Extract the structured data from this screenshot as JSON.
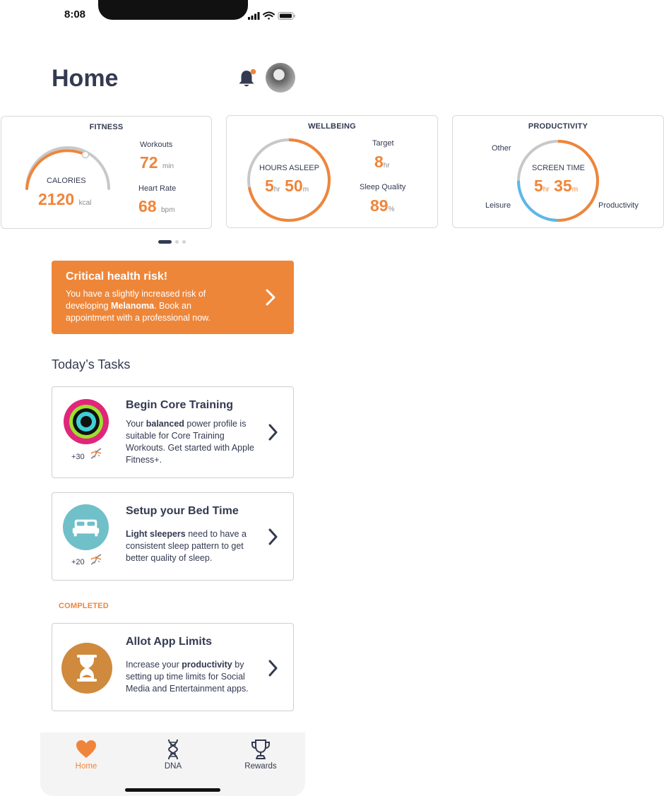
{
  "status_bar": {
    "time": "8:08"
  },
  "header": {
    "title": "Home"
  },
  "cards": {
    "fitness": {
      "title": "FITNESS",
      "calories_label": "CALORIES",
      "calories_value": "2120",
      "calories_unit": "kcal",
      "workouts_label": "Workouts",
      "workouts_value": "72",
      "workouts_unit": "min",
      "heart_rate_label": "Heart Rate",
      "heart_rate_value": "68",
      "heart_rate_unit": "bpm"
    },
    "wellbeing": {
      "title": "WELLBEING",
      "hours_label": "HOURS ASLEEP",
      "hours_value": "5",
      "hours_unit": "hr",
      "minutes_value": "50",
      "minutes_unit": "m",
      "target_label": "Target",
      "target_value": "8",
      "target_unit": "hr",
      "quality_label": "Sleep Quality",
      "quality_value": "89",
      "quality_unit": "%"
    },
    "productivity": {
      "title": "PRODUCTIVITY",
      "screen_label": "SCREEN TIME",
      "hours_value": "5",
      "hours_unit": "hr",
      "minutes_value": "35",
      "minutes_unit": "m",
      "legend_other": "Other",
      "legend_leisure": "Leisure",
      "legend_productivity": "Productivity"
    }
  },
  "alert": {
    "title": "Critical health risk!",
    "body_prefix": "You have a slightly increased risk of developing ",
    "body_bold": "Melanoma",
    "body_suffix": ". Book an appointment with a professional now."
  },
  "tasks_section": {
    "title": "Today’s Tasks"
  },
  "tasks": [
    {
      "title": "Begin Core Training",
      "desc_prefix": "Your ",
      "desc_bold": "balanced",
      "desc_suffix": " power profile is suitable for Core Training Workouts. Get started with Apple Fitness+.",
      "points": "+30"
    },
    {
      "title": "Setup your Bed Time",
      "desc_prefix": "",
      "desc_bold": "Light sleepers",
      "desc_suffix": " need to have a consistent sleep pattern to get better quality of sleep.",
      "points": "+20"
    }
  ],
  "completed_section": {
    "label": "COMPLETED"
  },
  "completed_tasks": [
    {
      "title": "Allot App Limits",
      "desc_prefix": "Increase your ",
      "desc_bold": "productivity",
      "desc_suffix": " by setting up time limits for Social Media and Entertainment apps."
    }
  ],
  "tabbar": {
    "items": [
      {
        "label": "Home",
        "icon": "heart-icon",
        "active": true
      },
      {
        "label": "DNA",
        "icon": "dna-icon",
        "active": false
      },
      {
        "label": "Rewards",
        "icon": "trophy-icon",
        "active": false
      }
    ]
  },
  "colors": {
    "accent": "#ef853a",
    "text": "#333a51",
    "ring_gray": "#c8c8c8",
    "leisure_blue": "#5bb8e8",
    "task_bed_teal": "#6fc0c8",
    "task_hourglass": "#cf8a3e"
  },
  "progress": {
    "calories_arc_fraction": 0.85,
    "sleep_ring_fraction": 0.72,
    "screen_productivity_fraction": 0.55,
    "screen_leisure_fraction": 0.25
  }
}
